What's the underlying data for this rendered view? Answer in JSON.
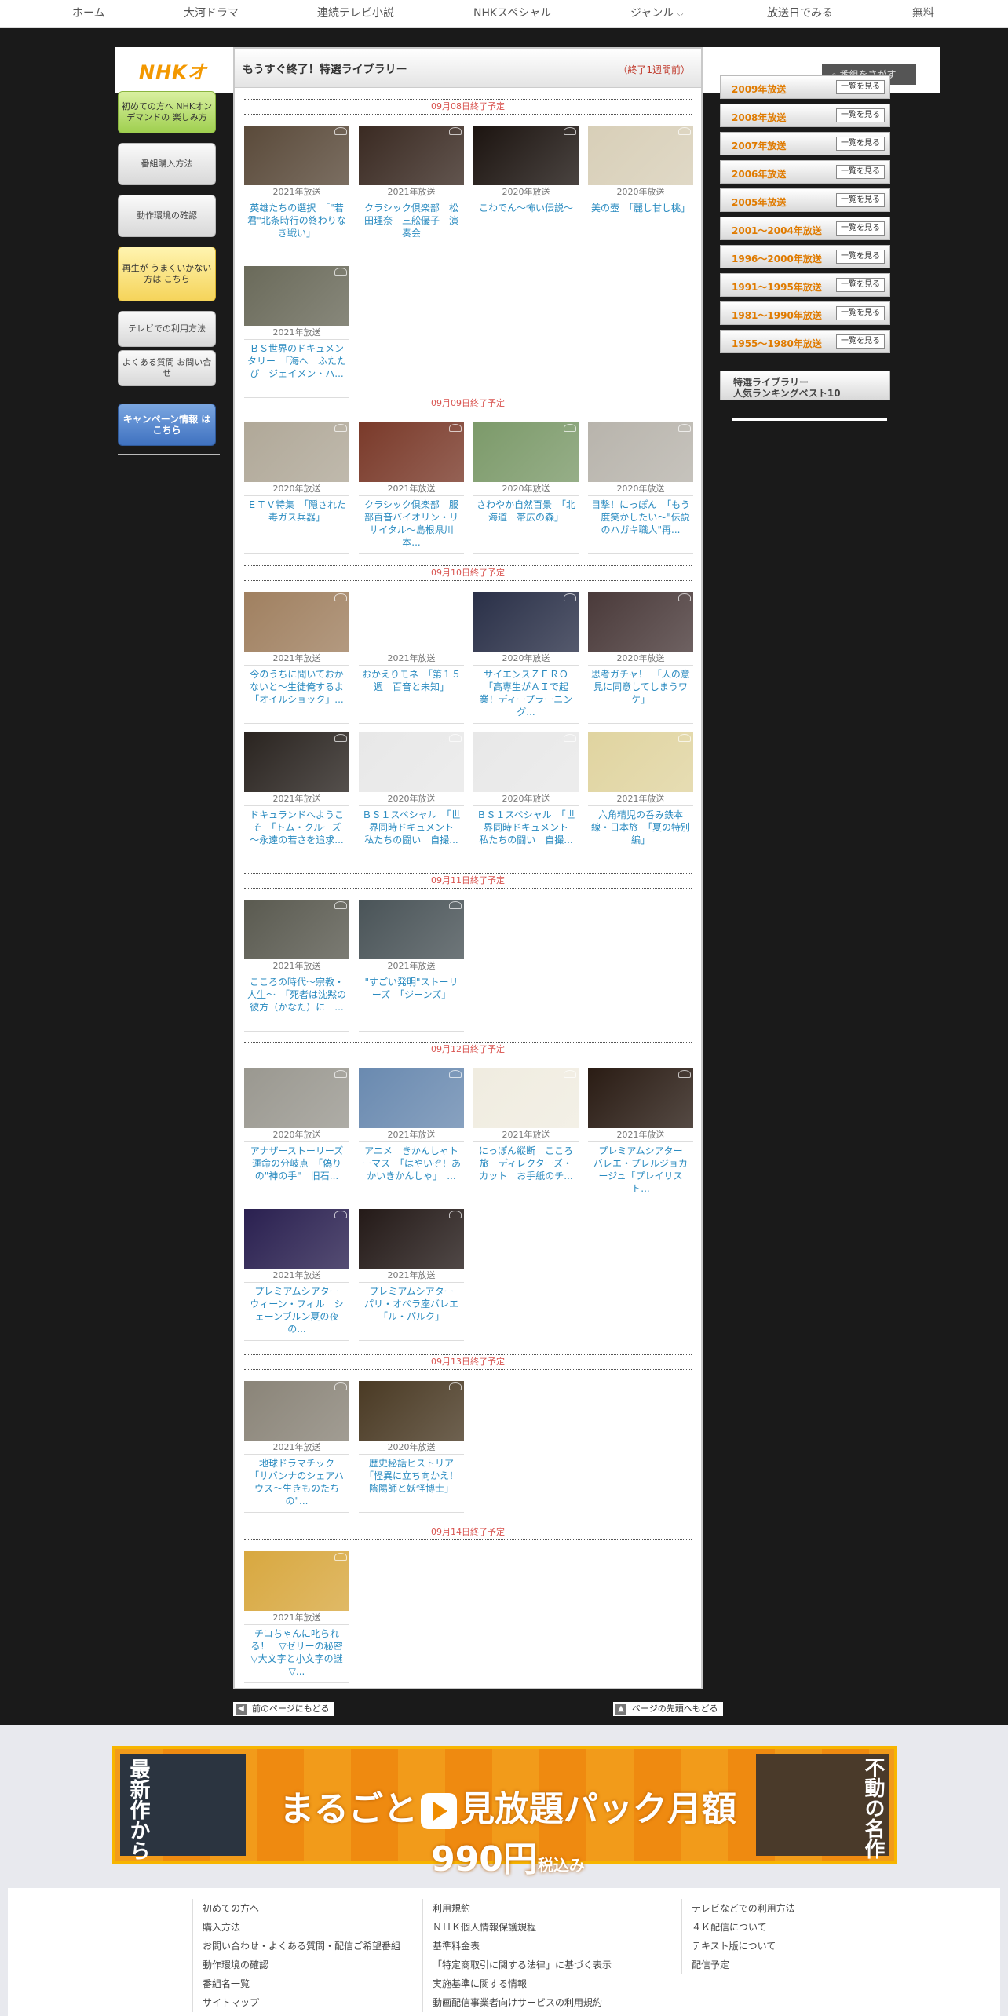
{
  "nav": {
    "items": [
      "ホーム",
      "大河ドラマ",
      "連続テレビ小説",
      "NHKスペシャル",
      "ジャンル",
      "放送日でみる",
      "無料"
    ]
  },
  "header": {
    "logo": "NHKオ",
    "search_placeholder": "番組をさがす"
  },
  "panel": {
    "title": "もうすぐ終了！特選ライブラリー",
    "note": "（終了1週間前）"
  },
  "left_menu": {
    "first_time": "初めての方へ NHKオンデマンドの 楽しみ方",
    "purchase": "番組購入方法",
    "check_env": "動作環境の確認",
    "playback": "再生が うまくいかない方は こちら",
    "tv_usage": "テレビでの利用方法",
    "faq": "よくある質問 お問い合せ",
    "campaign": "キャンペーン情報 はこちら"
  },
  "sections": [
    {
      "date": "09月08日終了予定",
      "items": [
        {
          "year": "2021年放送",
          "title": "英雄たちの選択　「\"若君\"北条時行の終わりなき戦い」",
          "color": "#5a4a3a"
        },
        {
          "year": "2021年放送",
          "title": "クラシック倶楽部　松田理奈　三舩優子　演奏会",
          "color": "#3a2a22"
        },
        {
          "year": "2020年放送",
          "title": "こわでん～怖い伝説～",
          "color": "#1c1410"
        },
        {
          "year": "2020年放送",
          "title": "美の壺　「麗し甘し桃」",
          "color": "#d8cfb8"
        },
        {
          "year": "2021年放送",
          "title": "ＢＳ世界のドキュメンタリー　「海へ　ふたたび　ジェイメン・ハ...",
          "color": "#6a6a5a"
        }
      ]
    },
    {
      "date": "09月09日終了予定",
      "items": [
        {
          "year": "2020年放送",
          "title": "ＥＴＶ特集　「隠された毒ガス兵器」",
          "color": "#b0a898"
        },
        {
          "year": "2021年放送",
          "title": "クラシック倶楽部　服部百音バイオリン・リサイタル～島根県川本...",
          "color": "#7a3a2a"
        },
        {
          "year": "2020年放送",
          "title": "さわやか自然百景　「北海道　帯広の森」",
          "color": "#7c9a6a"
        },
        {
          "year": "2020年放送",
          "title": "目撃！にっぽん　「もう一度笑かしたい～\"伝説のハガキ職人\"再...",
          "color": "#b8b4ac"
        }
      ]
    },
    {
      "date": "09月10日終了予定",
      "items": [
        {
          "year": "2021年放送",
          "title": "今のうちに聞いておかないと～生徒俺するよ　「オイルショック」...",
          "color": "#a08060"
        },
        {
          "year": "2021年放送",
          "title": "おかえりモネ　「第１５週　百音と未知」",
          "color": "#ffffff"
        },
        {
          "year": "2020年放送",
          "title": "サイエンスＺＥＲＯ　「高専生がＡＩで起業！ディープラーニング...",
          "color": "#2a3048"
        },
        {
          "year": "2020年放送",
          "title": "思考ガチャ！　「人の意見に同意してしまうワケ」",
          "color": "#4a3a3a"
        },
        {
          "year": "2021年放送",
          "title": "ドキュランドへようこそ　「トム・クルーズ　～永遠の若さを追求...",
          "color": "#2a2420"
        },
        {
          "year": "2020年放送",
          "title": "ＢＳ１スペシャル　「世界同時ドキュメント　私たちの闘い　自撮...",
          "color": "#e8e8e8"
        },
        {
          "year": "2020年放送",
          "title": "ＢＳ１スペシャル　「世界同時ドキュメント　私たちの闘い　自撮...",
          "color": "#e8e8e8"
        },
        {
          "year": "2021年放送",
          "title": "六角精児の呑み鉄本線・日本旅　「夏の特別編」",
          "color": "#e0d4a0"
        }
      ]
    },
    {
      "date": "09月11日終了予定",
      "items": [
        {
          "year": "2021年放送",
          "title": "こころの時代～宗教・人生～　「死者は沈黙の彼方（かなた）に　...",
          "color": "#5a5a50"
        },
        {
          "year": "2021年放送",
          "title": "\"すごい発明\"ストーリーズ　「ジーンズ」",
          "color": "#4a5458"
        }
      ]
    },
    {
      "date": "09月12日終了予定",
      "items": [
        {
          "year": "2020年放送",
          "title": "アナザーストーリーズ　運命の分岐点　「偽りの\"神の手\"　旧石...",
          "color": "#9a9890"
        },
        {
          "year": "2021年放送",
          "title": "アニメ　きかんしゃトーマス　「はやいぞ！あかいきかんしゃ」　...",
          "color": "#6a8ab0"
        },
        {
          "year": "2021年放送",
          "title": "にっぽん縦断　こころ旅　ディレクターズ・カット　お手紙のチ...",
          "color": "#f0ece0"
        },
        {
          "year": "2021年放送",
          "title": "プレミアムシアター　バレエ・プレルジョカージュ「プレイリスト...",
          "color": "#2a1c14"
        },
        {
          "year": "2021年放送",
          "title": "プレミアムシアター　ウィーン・フィル　シェーンブルン夏の夜の...",
          "color": "#2a2050"
        },
        {
          "year": "2021年放送",
          "title": "プレミアムシアター　パリ・オペラ座バレエ「ル・パルク」",
          "color": "#241a18"
        }
      ]
    },
    {
      "date": "09月13日終了予定",
      "items": [
        {
          "year": "2021年放送",
          "title": "地球ドラマチック　「サバンナのシェアハウス～生きものたちの\"...",
          "color": "#8a8478"
        },
        {
          "year": "2020年放送",
          "title": "歴史秘話ヒストリア　「怪異に立ち向かえ！陰陽師と妖怪博士」",
          "color": "#4a3a24"
        }
      ]
    },
    {
      "date": "09月14日終了予定",
      "items": [
        {
          "year": "2021年放送",
          "title": "チコちゃんに叱られる！　▽ゼリーの秘密▽大文字と小文字の謎▽...",
          "color": "#d8a840"
        }
      ]
    }
  ],
  "years": [
    {
      "label": "2009年放送",
      "btn": "一覧を見る"
    },
    {
      "label": "2008年放送",
      "btn": "一覧を見る"
    },
    {
      "label": "2007年放送",
      "btn": "一覧を見る"
    },
    {
      "label": "2006年放送",
      "btn": "一覧を見る"
    },
    {
      "label": "2005年放送",
      "btn": "一覧を見る"
    },
    {
      "label": "2001～2004年放送",
      "btn": "一覧を見る"
    },
    {
      "label": "1996～2000年放送",
      "btn": "一覧を見る"
    },
    {
      "label": "1991～1995年放送",
      "btn": "一覧を見る"
    },
    {
      "label": "1981～1990年放送",
      "btn": "一覧を見る"
    },
    {
      "label": "1955～1980年放送",
      "btn": "一覧を見る"
    }
  ],
  "ranking": {
    "line1": "特選ライブラリー",
    "line2": "人気ランキングベスト10"
  },
  "page_nav": {
    "prev": "前のページにもどる",
    "top": "ページの先頭へもどる"
  },
  "banner": {
    "left": "最新作から",
    "main_a": "まるごと",
    "main_b": "見放題パック",
    "main_c": "月額990円",
    "tax": "税込み",
    "right": "不動の名作"
  },
  "footer": {
    "col1": [
      "初めての方へ",
      "購入方法",
      "お問い合わせ・よくある質問・配信ご希望番組",
      "動作環境の確認",
      "番組名一覧",
      "サイトマップ"
    ],
    "col2": [
      "利用規約",
      "ＮＨＫ個人情報保護規程",
      "基準料金表",
      "「特定商取引に関する法律」に基づく表示",
      "実施基準に関する情報",
      "動画配信事業者向けサービスの利用規約"
    ],
    "col3": [
      "テレビなどでの利用方法",
      "４Ｋ配信について",
      "テキスト版について",
      "配信予定"
    ]
  }
}
